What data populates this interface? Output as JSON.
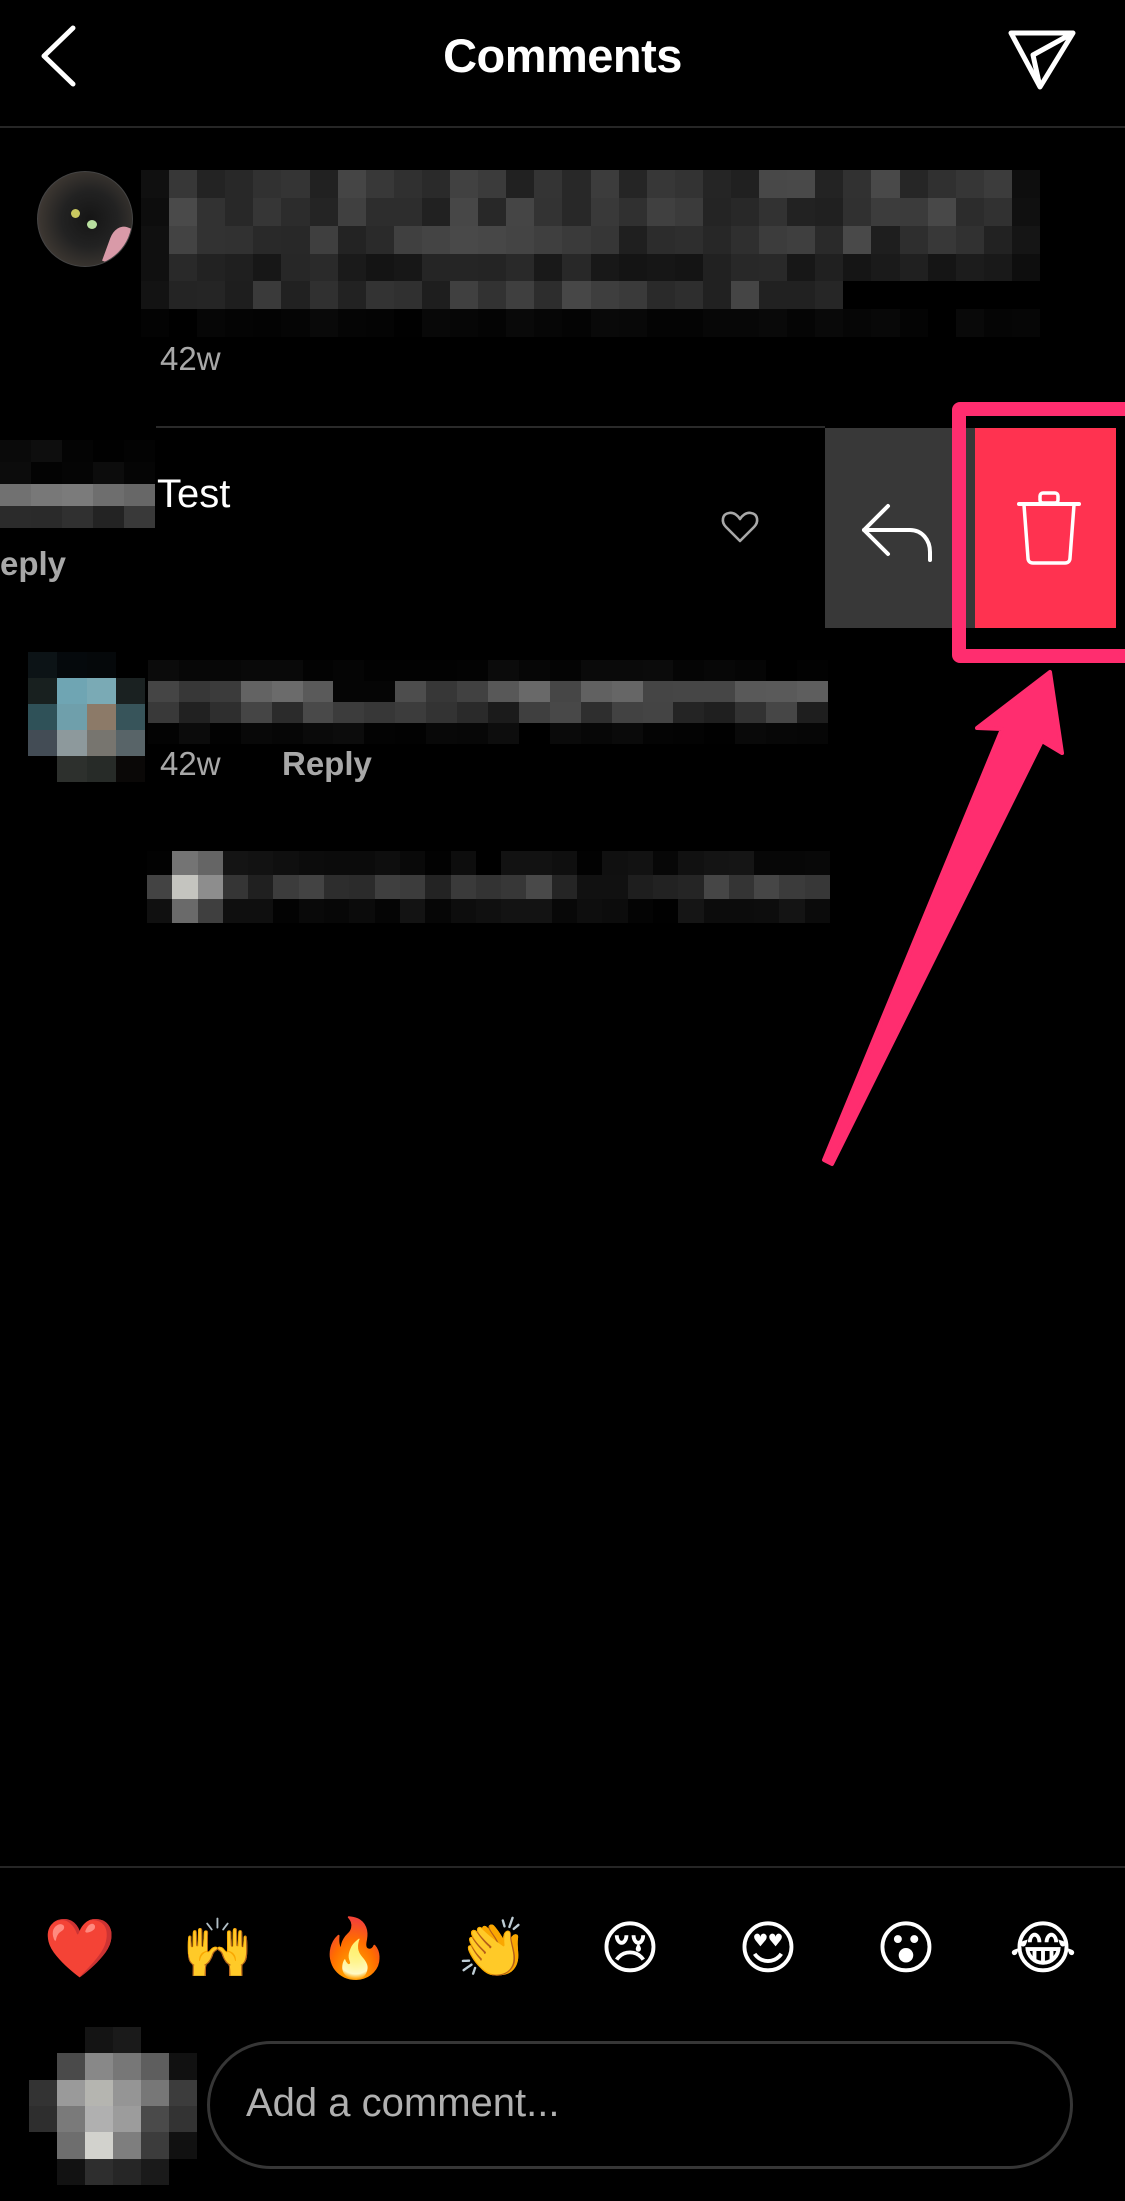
{
  "header": {
    "title": "Comments",
    "back_icon": "chevron-left-icon",
    "share_icon": "paper-plane-send-icon"
  },
  "caption": {
    "avatar_icon": "black-cat-avatar",
    "text_redacted": true,
    "timestamp": "42w"
  },
  "swiped_comment": {
    "text": "Test",
    "reply_label": "eply",
    "username_redacted": true,
    "like_icon": "heart-outline-icon",
    "actions": {
      "reply_icon": "reply-arrow-icon",
      "delete_icon": "trash-icon",
      "delete_color": "#ff3250",
      "reply_bg": "#383838"
    }
  },
  "comments": [
    {
      "text_redacted": true,
      "timestamp": "42w",
      "reply_label": "Reply"
    }
  ],
  "reply_thread": {
    "text_redacted": true
  },
  "quick_reactions": [
    "❤️",
    "🙌",
    "🔥",
    "👏",
    "😢",
    "😍",
    "😮",
    "😂"
  ],
  "composer": {
    "placeholder": "Add a comment...",
    "value": ""
  },
  "annotation": {
    "color": "#ff2d6f",
    "highlight_target": "delete-button",
    "arrow": true
  }
}
